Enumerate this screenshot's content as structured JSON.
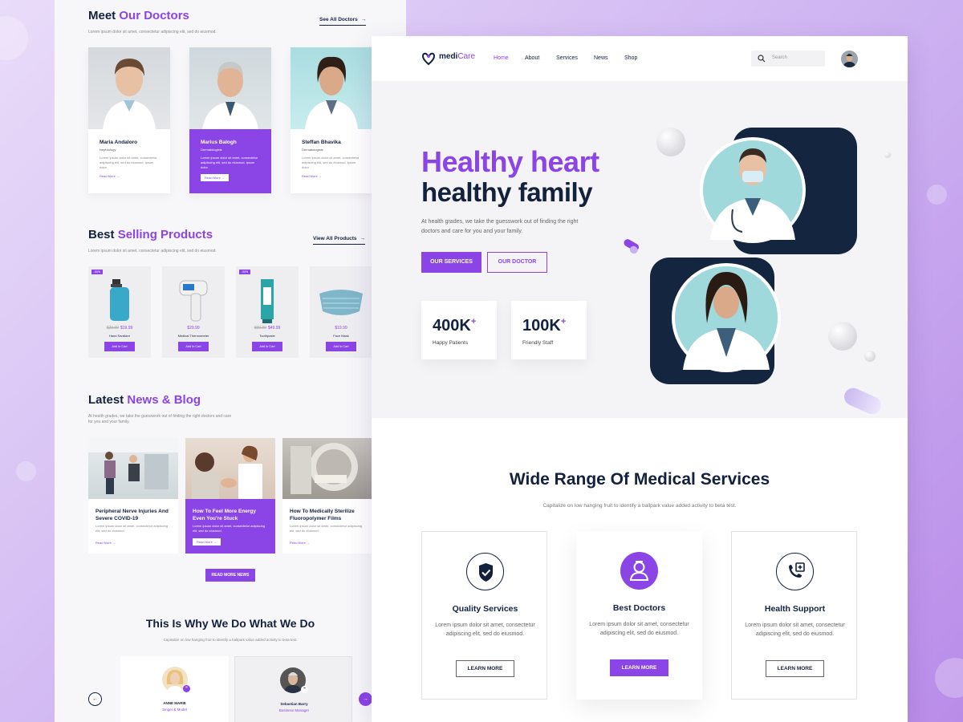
{
  "doctors_section": {
    "title_prefix": "Meet",
    "title_accent": "Our Doctors",
    "subtitle": "Lorem ipsum dolor sit amet, consectetur adipiscing elit, sed do eiusmod.",
    "see_all": "See All Doctors",
    "cards": [
      {
        "name": "Maria Andaloro",
        "spec": "Nephrology",
        "text": "Lorem ipsum dolor sit amet, consectetur adipiscing elit, sed do eiusmod. ipsum dolor",
        "more": "Read More"
      },
      {
        "name": "Marius Balogh",
        "spec": "Dermatologists",
        "text": "Lorem ipsum dolor sit amet, consectetur adipiscing elit, sed do eiusmod. ipsum dolor",
        "more": "Read More"
      },
      {
        "name": "Steffan Bhavika",
        "spec": "Dermatologists",
        "text": "Lorem ipsum dolor sit amet, consectetur adipiscing elit, sed do eiusmod. ipsum dolor",
        "more": "Read More"
      }
    ]
  },
  "products_section": {
    "title_prefix": "Best",
    "title_accent": "Selling Products",
    "subtitle": "Lorem ipsum dolor sit amet, consectetur adipiscing elit, sed do eiusmod.",
    "view_all": "View All Products",
    "items": [
      {
        "badge": "-50%",
        "old_price": "$29.99",
        "price": "$19.99",
        "name": "Hand Sanitizer",
        "cart": "Add to Cart"
      },
      {
        "badge": "",
        "old_price": "",
        "price": "$29.99",
        "name": "Medical Thermometer",
        "cart": "Add to Cart"
      },
      {
        "badge": "-50%",
        "old_price": "$99.99",
        "price": "$49.99",
        "name": "Toothpaste",
        "cart": "Add to Cart"
      },
      {
        "badge": "",
        "old_price": "",
        "price": "$19.99",
        "name": "Face Mask",
        "cart": "Add to Cart"
      }
    ]
  },
  "news_section": {
    "title_prefix": "Latest",
    "title_accent": "News & Blog",
    "subtitle": "At health grades, we take the guesswork out of finding the right doctors and care for you and your family.",
    "posts": [
      {
        "title": "Peripheral Nerve Injuries And Severe COVID-19",
        "text": "Lorem ipsum dolor sit amet, consectetur adipiscing elit, sed do eiusmod.",
        "more": "Read More"
      },
      {
        "title": "How To Feel More Energy Even You're Stuck",
        "text": "Lorem ipsum dolor sit amet, consectetur adipiscing elit, sed do eiusmod.",
        "more": "Read More"
      },
      {
        "title": "How To Medically Sterilize Fluoropolymer Films",
        "text": "Lorem ipsum dolor sit amet, consectetur adipiscing elit, sed do eiusmod.",
        "more": "Read More"
      }
    ],
    "read_more_news": "READ MORE NEWS"
  },
  "why_section": {
    "title": "This Is Why We Do What We Do",
    "subtitle": "Capitalize on low hanging fruit to identify a ballpark value added activity to beta test.",
    "people": [
      {
        "name": "ANNE MARIE",
        "role": "Singer & Model"
      },
      {
        "name": "Sebastian Barry",
        "role": "Business Manager"
      }
    ]
  },
  "nav": {
    "logo_a": "medi",
    "logo_b": "Care",
    "items": [
      "Home",
      "About",
      "Services",
      "News",
      "Shop"
    ],
    "search_placeholder": "Search"
  },
  "hero": {
    "line1": "Healthy heart",
    "line2": "healthy family",
    "paragraph": "At health grades, we take the guesswork out of finding the right doctors and care for you and your family.",
    "btn_services": "OUR SERVICES",
    "btn_doctor": "OUR DOCTOR",
    "stats": [
      {
        "value": "400K",
        "plus": "+",
        "label": "Happy Patients"
      },
      {
        "value": "100K",
        "plus": "+",
        "label": "Friendly Staff"
      }
    ]
  },
  "services": {
    "title": "Wide Range Of Medical Services",
    "subtitle": "Capitalize on low hanging fruit to identify a ballpark value added activity to beta test.",
    "cards": [
      {
        "title": "Quality Services",
        "text": "Lorem ipsum dolor sit amet, consectetur adipiscing elit, sed do eiusmod.",
        "btn": "LEARN MORE",
        "icon": "shield-check-icon"
      },
      {
        "title": "Best Doctors",
        "text": "Lorem ipsum dolor sit amet, consectetur adipiscing elit, sed do eiusmod.",
        "btn": "LEARN MORE",
        "icon": "doctor-icon"
      },
      {
        "title": "Health Support",
        "text": "Lorem ipsum dolor sit amet, consectetur adipiscing elit, sed do eiusmod.",
        "btn": "LEARN MORE",
        "icon": "phone-plus-icon"
      }
    ]
  },
  "colors": {
    "accent": "#8b44e6",
    "navy": "#14213d",
    "hero_bg": "#f4f4f6"
  }
}
